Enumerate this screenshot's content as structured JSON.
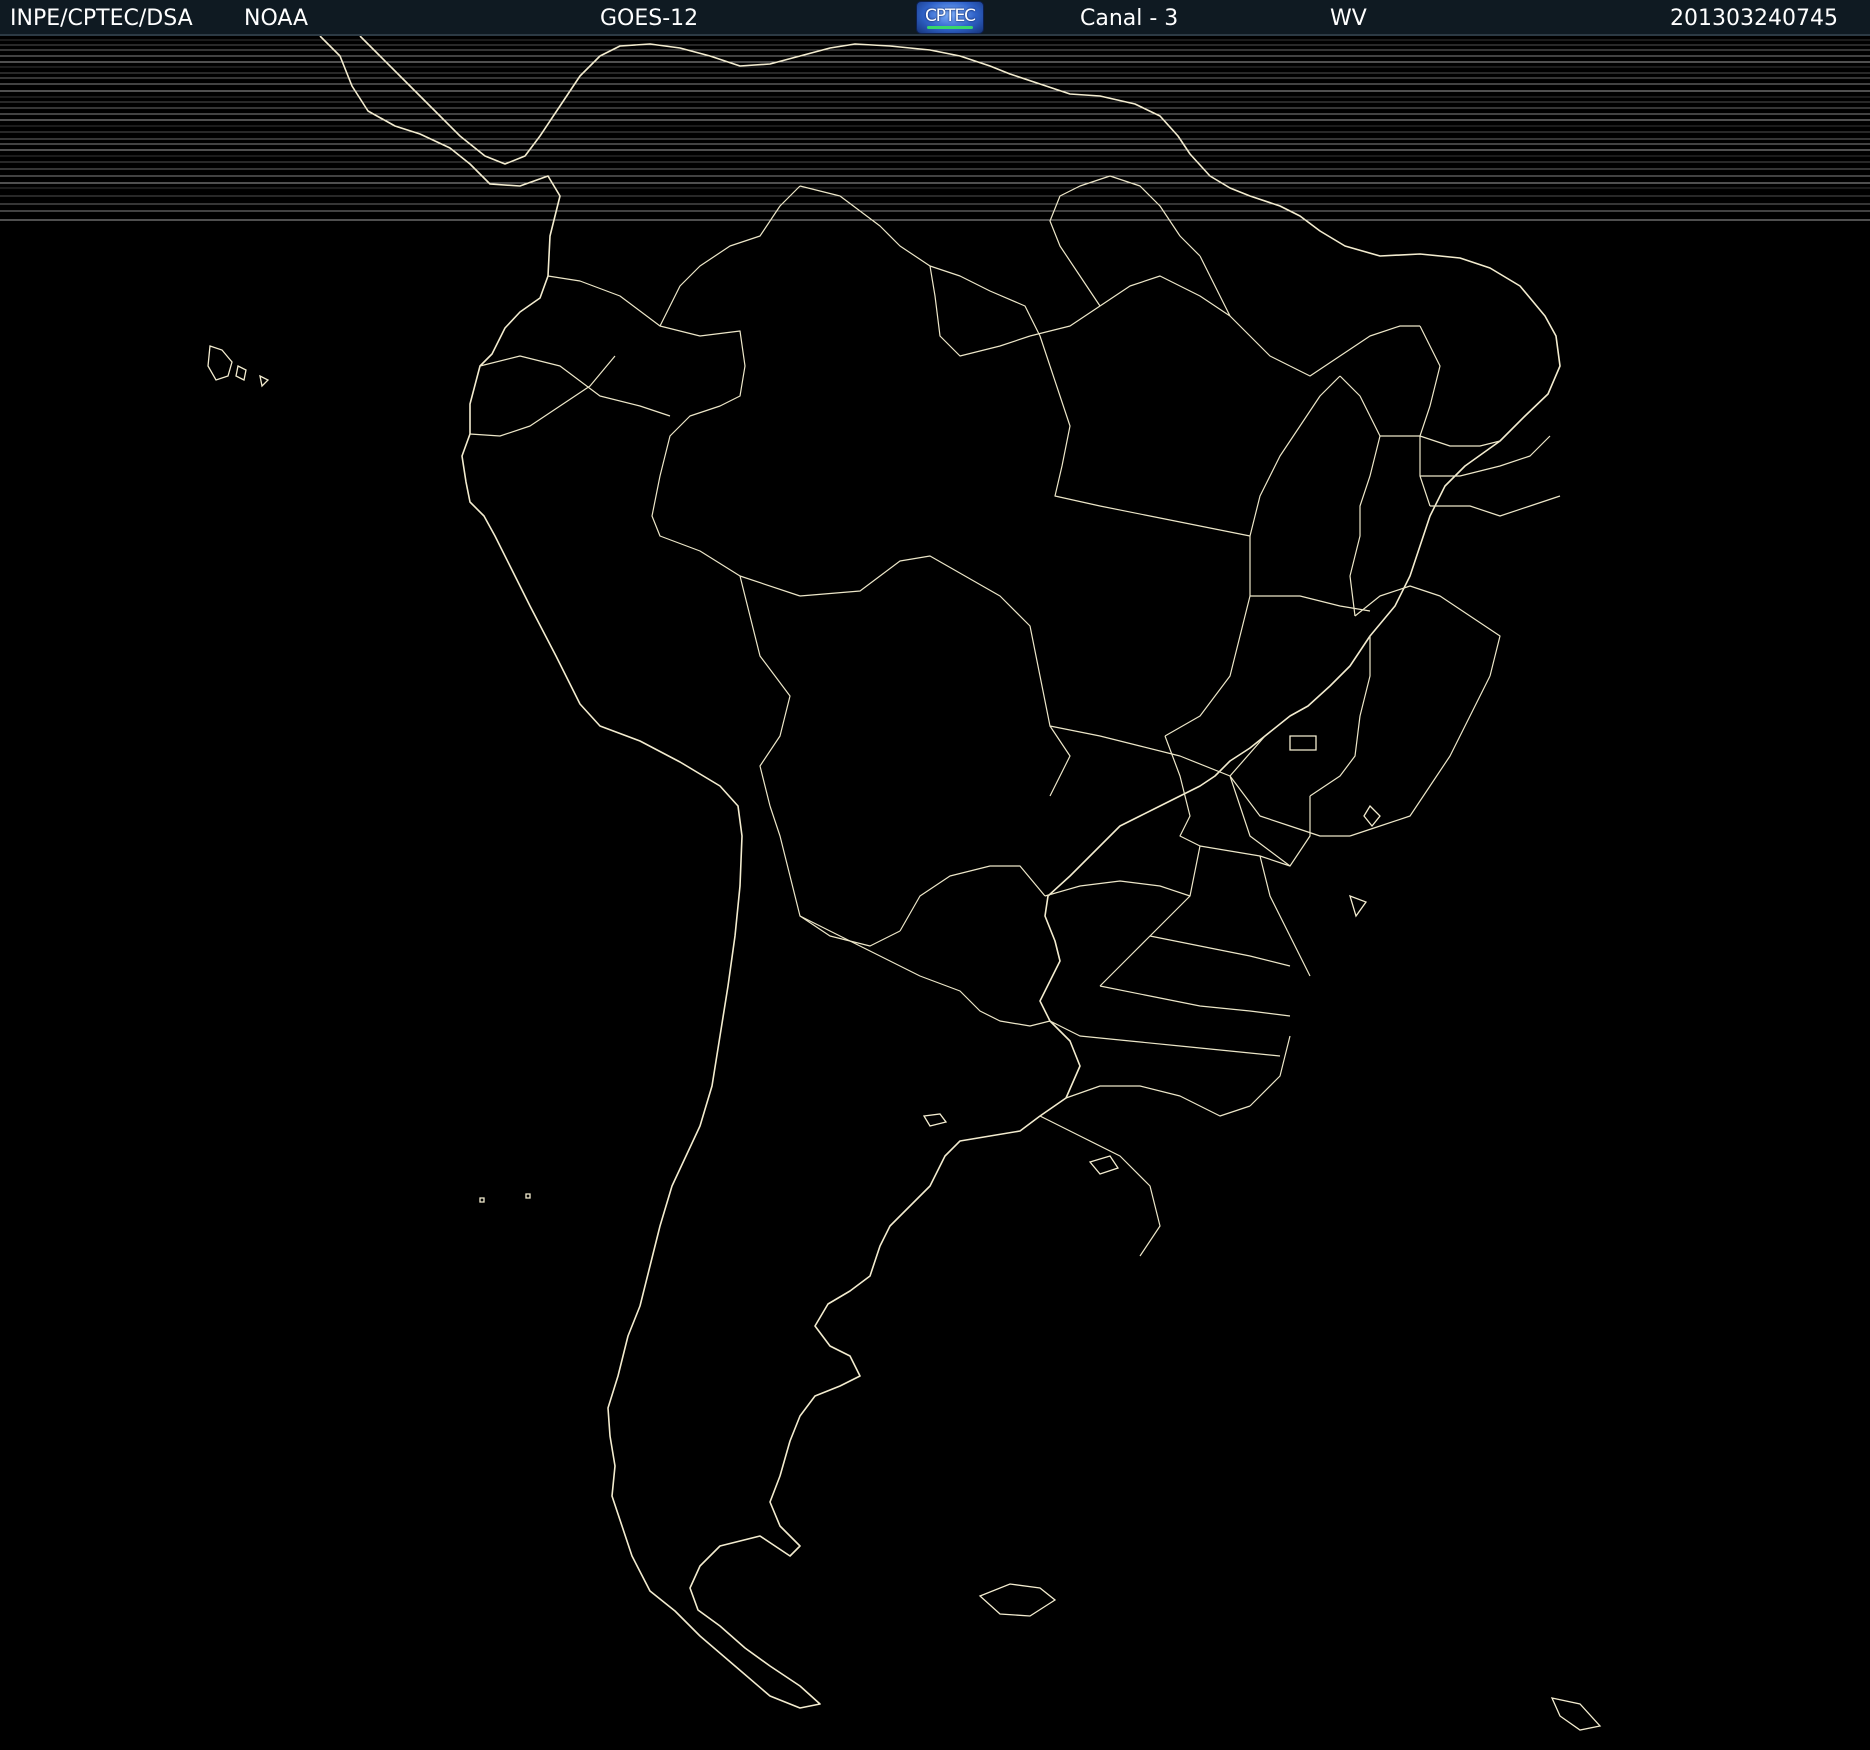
{
  "header": {
    "agency": "INPE/CPTEC/DSA",
    "organization": "NOAA",
    "satellite": "GOES-12",
    "logo_text": "CPTEC",
    "channel": "Canal - 3",
    "band": "WV",
    "timestamp": "201303240745"
  },
  "colors": {
    "background": "#000000",
    "header_background": "#0f1a22",
    "header_text": "#ffffff",
    "coastline": "#f3eccf",
    "logo_blue": "#2f62c8",
    "logo_green": "#38d86a"
  },
  "map": {
    "region": "South America",
    "features": [
      "coastlines",
      "country borders",
      "Brazilian state borders",
      "islands"
    ],
    "artifacts": "horizontal scan-line noise in the northern band"
  }
}
